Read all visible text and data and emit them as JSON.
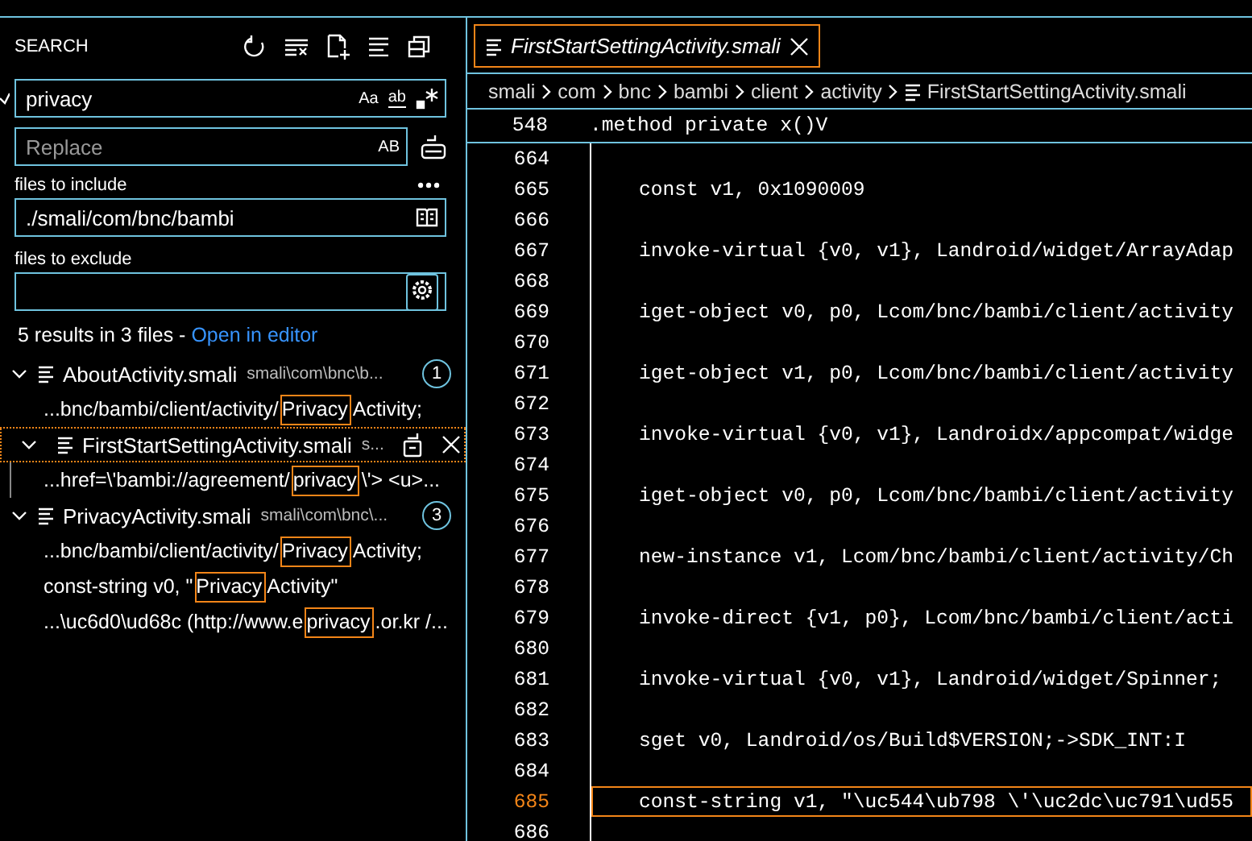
{
  "search": {
    "title": "SEARCH",
    "query": "privacy",
    "case_toggle": "Aa",
    "word_toggle": "ab",
    "replace_placeholder": "Replace",
    "preserve_case_toggle": "AB",
    "include_label": "files to include",
    "include_value": "./smali/com/bnc/bambi",
    "exclude_label": "files to exclude",
    "summary": "5 results in 3 files - ",
    "open_link": "Open in editor"
  },
  "results": [
    {
      "name": "AboutActivity.smali",
      "path": "smali\\com\\bnc\\b...",
      "count": "1",
      "expanded": true,
      "hovered": false,
      "matches": [
        {
          "before": "...bnc/bambi/client/activity/",
          "match": "Privacy",
          "after": "Activity;"
        }
      ]
    },
    {
      "name": "FirstStartSettingActivity.smali",
      "path": "s...",
      "expanded": true,
      "hovered": true,
      "matches": [
        {
          "before": "...href=\\'bambi://agreement/",
          "match": "privacy",
          "after": "\\'> <u>..."
        }
      ]
    },
    {
      "name": "PrivacyActivity.smali",
      "path": "smali\\com\\bnc\\...",
      "count": "3",
      "expanded": true,
      "hovered": false,
      "matches": [
        {
          "before": "...bnc/bambi/client/activity/",
          "match": "Privacy",
          "after": "Activity;"
        },
        {
          "before": "const-string v0, \"",
          "match": "Privacy",
          "after": "Activity\""
        },
        {
          "before": "...\\uc6d0\\ud68c (http://www.e",
          "match": "privacy",
          "after": ".or.kr /..."
        }
      ]
    }
  ],
  "editor": {
    "tab": {
      "label": "FirstStartSettingActivity.smali",
      "selected": true
    },
    "breadcrumbs": [
      "smali",
      "com",
      "bnc",
      "bambi",
      "client",
      "activity",
      "FirstStartSettingActivity.smali"
    ],
    "sticky": {
      "number": "548",
      "code": ".method private x()V"
    },
    "lines": [
      {
        "number": "664",
        "current": false
      },
      {
        "number": "665",
        "code": "    const v1, 0x1090009",
        "current": false
      },
      {
        "number": "666",
        "current": false
      },
      {
        "number": "667",
        "code": "    invoke-virtual {v0, v1}, Landroid/widget/ArrayAdap",
        "current": false
      },
      {
        "number": "668",
        "current": false
      },
      {
        "number": "669",
        "code": "    iget-object v0, p0, Lcom/bnc/bambi/client/activity",
        "current": false
      },
      {
        "number": "670",
        "current": false
      },
      {
        "number": "671",
        "code": "    iget-object v1, p0, Lcom/bnc/bambi/client/activity",
        "current": false
      },
      {
        "number": "672",
        "current": false
      },
      {
        "number": "673",
        "code": "    invoke-virtual {v0, v1}, Landroidx/appcompat/widge",
        "current": false
      },
      {
        "number": "674",
        "current": false
      },
      {
        "number": "675",
        "code": "    iget-object v0, p0, Lcom/bnc/bambi/client/activity",
        "current": false
      },
      {
        "number": "676",
        "current": false
      },
      {
        "number": "677",
        "code": "    new-instance v1, Lcom/bnc/bambi/client/activity/Ch",
        "current": false
      },
      {
        "number": "678",
        "current": false
      },
      {
        "number": "679",
        "code": "    invoke-direct {v1, p0}, Lcom/bnc/bambi/client/acti",
        "current": false
      },
      {
        "number": "680",
        "current": false
      },
      {
        "number": "681",
        "code": "    invoke-virtual {v0, v1}, Landroid/widget/Spinner;",
        "current": false
      },
      {
        "number": "682",
        "current": false
      },
      {
        "number": "683",
        "code": "    sget v0, Landroid/os/Build$VERSION;->SDK_INT:I",
        "current": false
      },
      {
        "number": "684",
        "current": false
      },
      {
        "number": "685",
        "code": "    const-string v1, \"\\uc544\\ub798 \\'\\uc2dc\\uc791\\ud55",
        "current": true
      },
      {
        "number": "686",
        "current": false
      }
    ]
  }
}
